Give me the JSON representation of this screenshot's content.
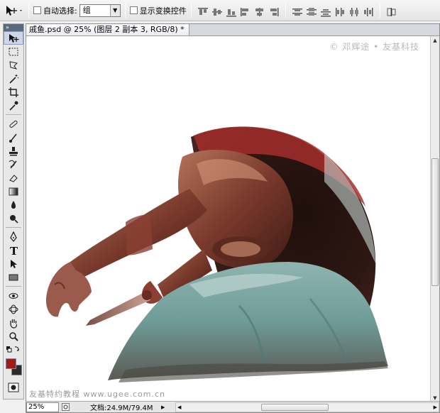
{
  "options_bar": {
    "auto_select_label": "自动选择:",
    "auto_select_value": "组",
    "show_transform_label": "显示变换控件"
  },
  "document": {
    "tab_title": "戚鱼.psd @ 25% (图层 2 副本 3, RGB/8) *",
    "close_glyph": "×",
    "watermark_top": "© 邓辉途 • 友基科技",
    "watermark_bottom": "友基特约教程 www.ugee.com.cn"
  },
  "status_bar": {
    "zoom": "25%",
    "doc_size": "文档:24.9M/79.4M"
  },
  "colors": {
    "foreground": "#9b1c1c",
    "background": "#2b2b2b"
  }
}
